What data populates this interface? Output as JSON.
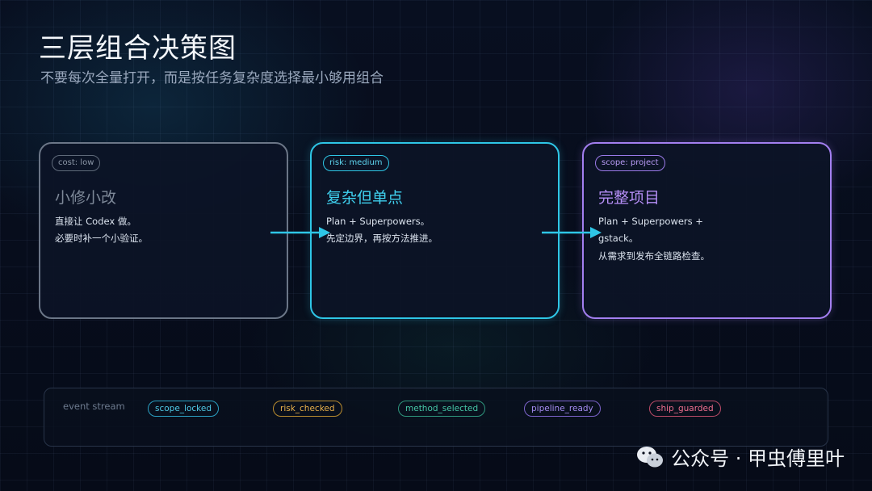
{
  "title": "三层组合决策图",
  "subtitle": "不要每次全量打开，而是按任务复杂度选择最小够用组合",
  "cards": [
    {
      "badge": "cost: low",
      "title": "小修小改",
      "lines": [
        "直接让 Codex 做。",
        "必要时补一个小验证。"
      ],
      "color": "#6b7687"
    },
    {
      "badge": "risk: medium",
      "title": "复杂但单点",
      "lines": [
        "Plan + Superpowers。",
        "先定边界，再按方法推进。"
      ],
      "color": "#2ec6e6"
    },
    {
      "badge": "scope: project",
      "title": "完整项目",
      "lines": [
        "Plan + Superpowers +",
        "gstack。",
        "从需求到发布全链路检查。"
      ],
      "color": "#a37ff0"
    }
  ],
  "event_stream": {
    "label": "event stream",
    "events": [
      "scope_locked",
      "risk_checked",
      "method_selected",
      "pipeline_ready",
      "ship_guarded"
    ]
  },
  "watermark": "公众号 · 甲虫傅里叶",
  "icons": {
    "arrow": "arrow-right-icon",
    "watermark": "wechat-icon"
  }
}
